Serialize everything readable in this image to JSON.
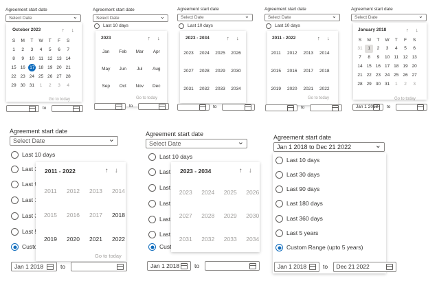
{
  "label": "Agreement start date",
  "select_placeholder": "Select Date",
  "to_label": "to",
  "go_to_today": "Go to today",
  "nav": {
    "up": "↑",
    "down": "↓"
  },
  "chevron": "⌄",
  "options": [
    "Last 10 days",
    "Last 30 days",
    "Last 90 days",
    "Last 180 days",
    "Last 360 days",
    "Last 5 years",
    "Custom Range (upto 5 years)"
  ],
  "options_partial": [
    "Last 10 days",
    "Last 3",
    "Last 9",
    "Last 1",
    "Last 3",
    "Last 5",
    "Custo"
  ],
  "weekdays": [
    "S",
    "M",
    "T",
    "W",
    "T",
    "F",
    "S"
  ],
  "panel1": {
    "title": "October 2023",
    "rows": [
      [
        "1",
        "2",
        "3",
        "4",
        "5",
        "6",
        "7"
      ],
      [
        "8",
        "9",
        "10",
        "11",
        "12",
        "13",
        "14"
      ],
      [
        "15",
        "16",
        "17",
        "18",
        "19",
        "20",
        "21"
      ],
      [
        "22",
        "23",
        "24",
        "25",
        "26",
        "27",
        "28"
      ],
      [
        "29",
        "30",
        "31",
        "1",
        "2",
        "3",
        "4"
      ]
    ],
    "today": "17"
  },
  "panel2": {
    "first_option": "Last 10 days",
    "title": "2023",
    "months": [
      "Jan",
      "Feb",
      "Mar",
      "Apr",
      "May",
      "Jun",
      "Jul",
      "Aug",
      "Sep",
      "Oct",
      "Nov",
      "Dec"
    ]
  },
  "panel3": {
    "first_option": "Last 10 days",
    "title": "2023 - 2034",
    "years": [
      "2023",
      "2024",
      "2025",
      "2026",
      "2027",
      "2028",
      "2029",
      "2030",
      "2031",
      "2032",
      "2033",
      "2034"
    ]
  },
  "panel4": {
    "first_option": "Last 10 days",
    "title": "2011 - 2022",
    "years": [
      "2011",
      "2012",
      "2013",
      "2014",
      "2015",
      "2016",
      "2017",
      "2018",
      "2019",
      "2020",
      "2021",
      "2022"
    ]
  },
  "panel5": {
    "title": "January 2018",
    "rows": [
      [
        "31",
        "1",
        "2",
        "3",
        "4",
        "5",
        "6"
      ],
      [
        "7",
        "8",
        "9",
        "10",
        "11",
        "12",
        "13"
      ],
      [
        "14",
        "15",
        "16",
        "17",
        "18",
        "19",
        "20"
      ],
      [
        "21",
        "22",
        "23",
        "24",
        "25",
        "26",
        "27"
      ],
      [
        "28",
        "29",
        "30",
        "31",
        "1",
        "2",
        "3"
      ]
    ],
    "selected": "1",
    "from_value": "Jan 1 2018"
  },
  "panel6": {
    "title": "2011 - 2022",
    "years": [
      "2011",
      "2012",
      "2013",
      "2014",
      "2015",
      "2016",
      "2017",
      "2018",
      "2019",
      "2020",
      "2021",
      "2022"
    ],
    "from_value": "Jan 1 2018"
  },
  "panel7": {
    "title": "2023 - 2034",
    "years": [
      "2023",
      "2024",
      "2025",
      "2026",
      "2027",
      "2028",
      "2029",
      "2030",
      "2031",
      "2032",
      "2033",
      "2034"
    ],
    "from_value": "Jan 1 2018"
  },
  "panel8": {
    "select_value": "Jan 1 2018 to Dec 21 2022",
    "from_value": "Jan 1 2018",
    "to_value": "Dec 21 2022",
    "selected_option": "Custom Range (upto 5 years)"
  }
}
